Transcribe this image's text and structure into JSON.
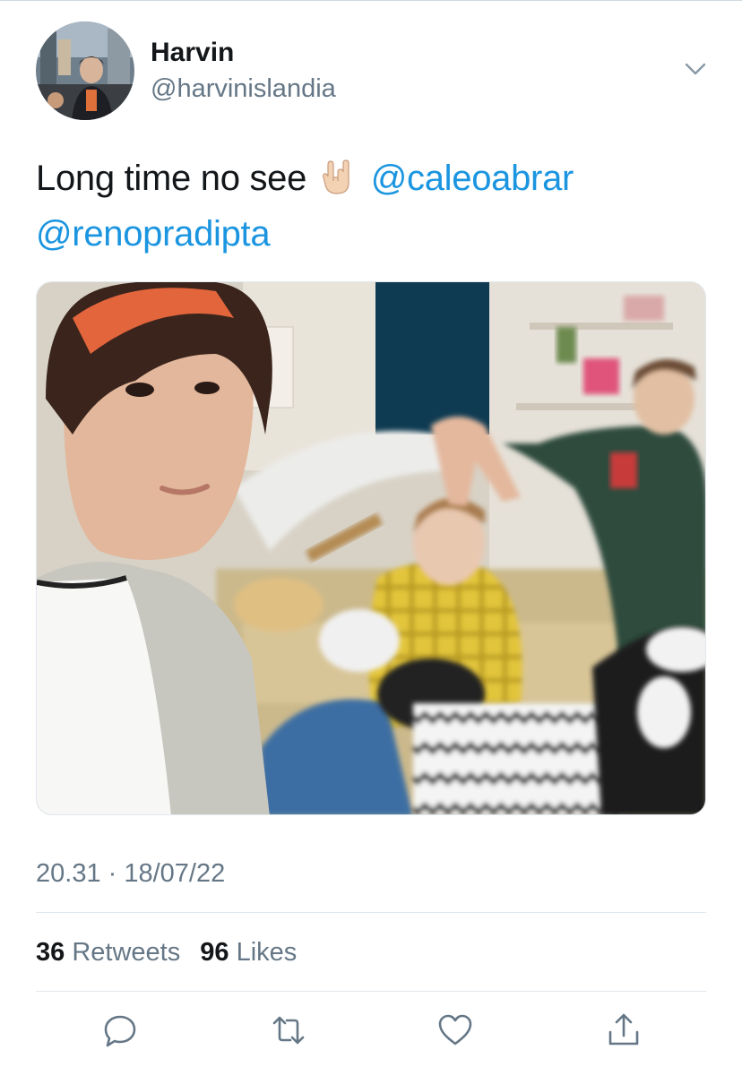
{
  "user": {
    "display_name": "Harvin",
    "handle": "@harvinislandia",
    "avatar_icon": "avatar-photo"
  },
  "tweet": {
    "text": "Long time no see",
    "emoji": "sign-of-horns-emoji",
    "mentions": [
      "@caleoabrar",
      "@renopradipta"
    ],
    "media_description_icon": "photo",
    "timestamp": "20.31 · 18/07/22"
  },
  "stats": {
    "retweets_count": "36",
    "retweets_label": "Retweets",
    "likes_count": "96",
    "likes_label": "Likes"
  },
  "actions": {
    "icons": [
      "reply-icon",
      "retweet-icon",
      "like-icon",
      "share-icon"
    ]
  },
  "colors": {
    "mention": "#1b95e0",
    "secondary_text": "#657786",
    "primary_text": "#14171a",
    "divider": "#e1e8ed"
  }
}
